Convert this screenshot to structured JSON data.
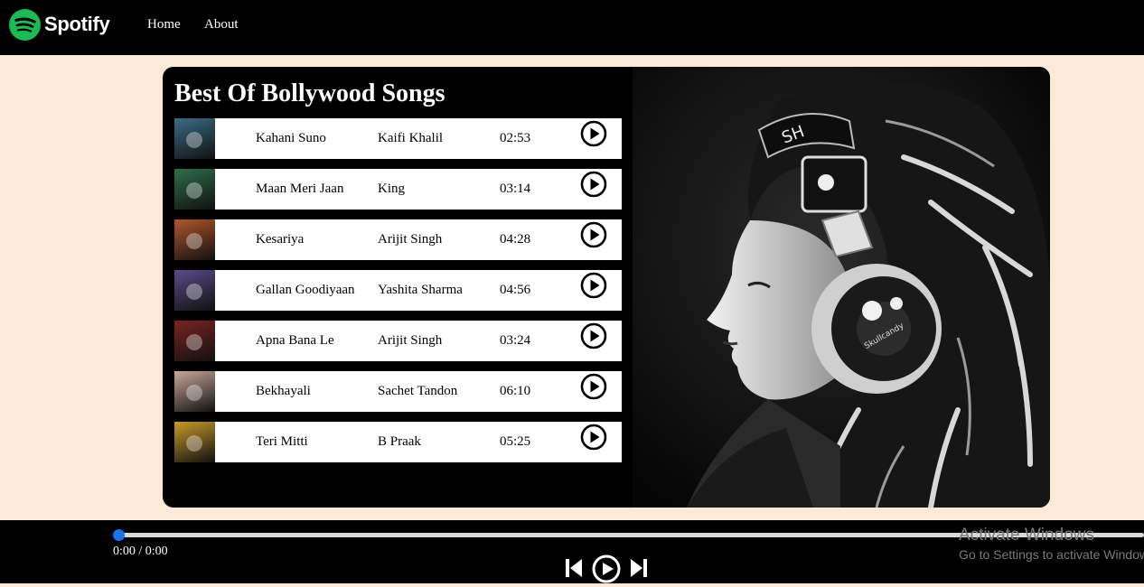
{
  "nav": {
    "brand": "Spotify",
    "links": [
      "Home",
      "About"
    ]
  },
  "playlist": {
    "title": "Best Of Bollywood Songs",
    "songs": [
      {
        "name": "Kahani Suno",
        "artist": "Kaifi Khalil",
        "duration": "02:53",
        "cover_color": "#3b6b86"
      },
      {
        "name": "Maan Meri Jaan",
        "artist": "King",
        "duration": "03:14",
        "cover_color": "#2f6e4a"
      },
      {
        "name": "Kesariya",
        "artist": "Arijit Singh",
        "duration": "04:28",
        "cover_color": "#b0562a"
      },
      {
        "name": "Gallan Goodiyaan",
        "artist": "Yashita Sharma",
        "duration": "04:56",
        "cover_color": "#5a4c8a"
      },
      {
        "name": "Apna Bana Le",
        "artist": "Arijit Singh",
        "duration": "03:24",
        "cover_color": "#7a2420"
      },
      {
        "name": "Bekhayali",
        "artist": "Sachet Tandon",
        "duration": "06:10",
        "cover_color": "#c9a79a"
      },
      {
        "name": "Teri Mitti",
        "artist": "B Praak",
        "duration": "05:25",
        "cover_color": "#c99a2a"
      }
    ]
  },
  "player": {
    "time": "0:00 / 0:00",
    "progress": 0,
    "accent": "#1a73e8"
  },
  "watermark": {
    "title": "Activate Windows",
    "subtitle": "Go to Settings to activate Windows."
  },
  "colors": {
    "brand": "#1db954",
    "page_bg": "#fbead7"
  }
}
